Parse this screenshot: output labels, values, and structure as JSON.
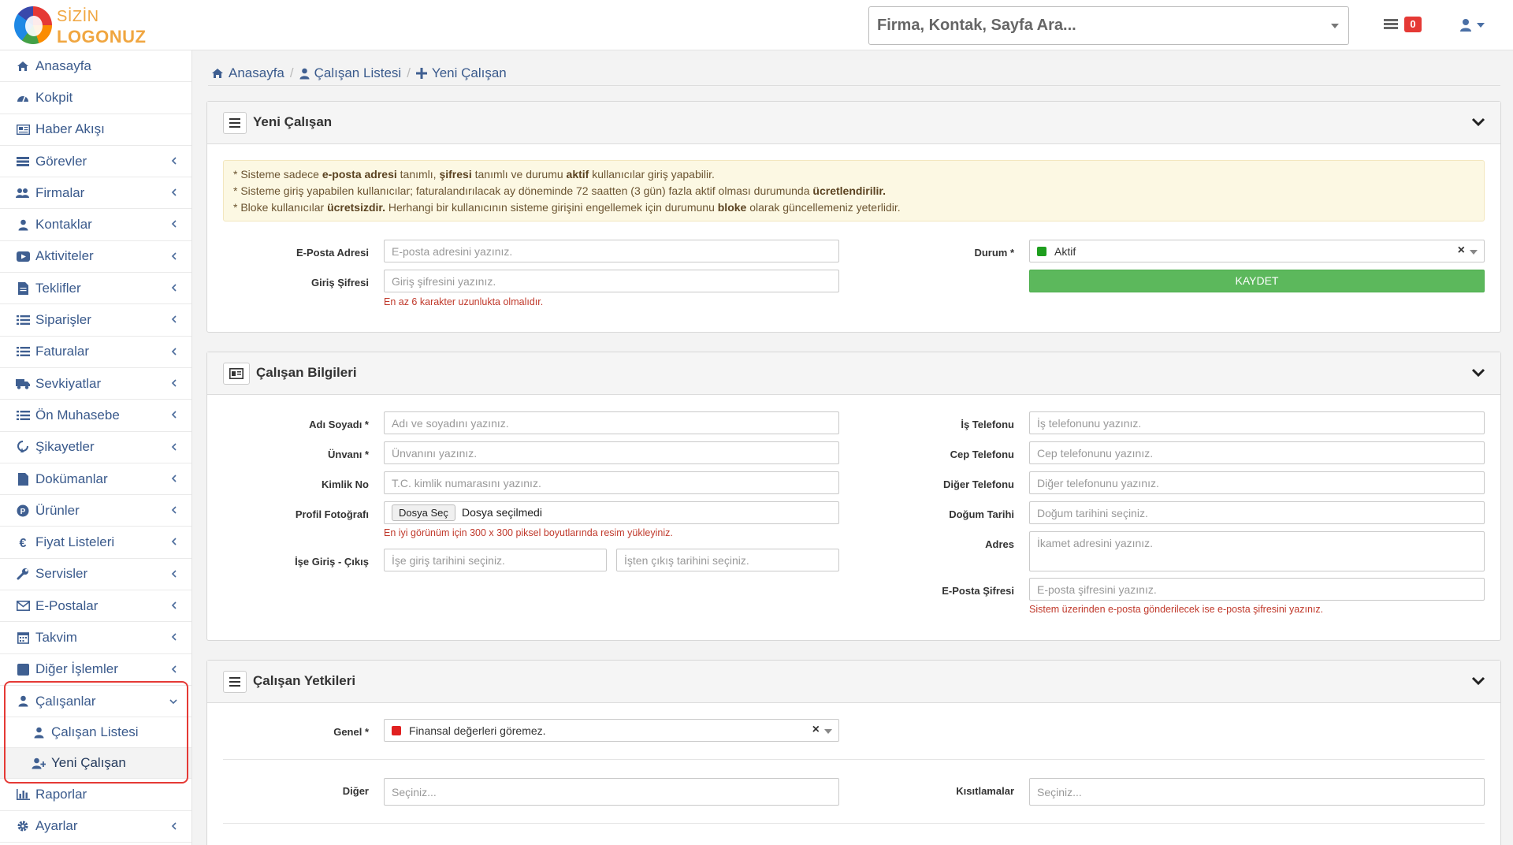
{
  "header": {
    "logo_line1": "SİZİN",
    "logo_line2": "LOGONUZ",
    "search_placeholder": "Firma, Kontak, Sayfa Ara...",
    "notification_count": "0"
  },
  "sidebar": {
    "items": [
      {
        "label": "Anasayfa",
        "icon": "home-icon"
      },
      {
        "label": "Kokpit",
        "icon": "dashboard-icon"
      },
      {
        "label": "Haber Akışı",
        "icon": "newspaper-icon"
      },
      {
        "label": "Görevler",
        "icon": "tasks-icon"
      },
      {
        "label": "Firmalar",
        "icon": "users-icon"
      },
      {
        "label": "Kontaklar",
        "icon": "user-icon"
      },
      {
        "label": "Aktiviteler",
        "icon": "video-icon"
      },
      {
        "label": "Teklifler",
        "icon": "document-icon"
      },
      {
        "label": "Siparişler",
        "icon": "list-icon"
      },
      {
        "label": "Faturalar",
        "icon": "list-icon"
      },
      {
        "label": "Sevkiyatlar",
        "icon": "truck-icon"
      },
      {
        "label": "Ön Muhasebe",
        "icon": "list-icon"
      },
      {
        "label": "Şikayetler",
        "icon": "bullhorn-icon"
      },
      {
        "label": "Dokümanlar",
        "icon": "file-icon"
      },
      {
        "label": "Ürünler",
        "icon": "product-icon"
      },
      {
        "label": "Fiyat Listeleri",
        "icon": "euro-icon"
      },
      {
        "label": "Servisler",
        "icon": "wrench-icon"
      },
      {
        "label": "E-Postalar",
        "icon": "envelope-icon"
      },
      {
        "label": "Takvim",
        "icon": "calendar-icon"
      },
      {
        "label": "Diğer İşlemler",
        "icon": "square-icon"
      },
      {
        "label": "Çalışanlar",
        "icon": "user-icon"
      }
    ],
    "sub_items": [
      {
        "label": "Çalışan Listesi",
        "icon": "user-icon"
      },
      {
        "label": "Yeni Çalışan",
        "icon": "user-plus-icon"
      }
    ],
    "after_items": [
      {
        "label": "Raporlar",
        "icon": "bar-chart-icon"
      },
      {
        "label": "Ayarlar",
        "icon": "gear-icon"
      }
    ]
  },
  "breadcrumb": {
    "home": "Anasayfa",
    "list": "Çalışan Listesi",
    "current": "Yeni Çalışan"
  },
  "panel_new": {
    "title": "Yeni Çalışan",
    "alert": {
      "line1_pre": "* Sisteme sadece ",
      "line1_b1": "e-posta adresi",
      "line1_mid1": " tanımlı, ",
      "line1_b2": "şifresi",
      "line1_mid2": " tanımlı ve durumu ",
      "line1_b3": "aktif",
      "line1_post": " kullanıcılar giriş yapabilir.",
      "line2_pre": "* Sisteme giriş yapabilen kullanıcılar; faturalandırılacak ay döneminde 72 saatten (3 gün) fazla aktif olması durumunda ",
      "line2_b": "ücretlendirilir.",
      "line3_pre": "* Bloke kullanıcılar ",
      "line3_b1": "ücretsizdir.",
      "line3_mid": " Herhangi bir kullanıcının sisteme girişini engellemek için durumunu ",
      "line3_b2": "bloke",
      "line3_post": " olarak güncellemeniz yeterlidir."
    },
    "email_label": "E-Posta Adresi",
    "email_placeholder": "E-posta adresini yazınız.",
    "password_label": "Giriş Şifresi",
    "password_placeholder": "Giriş şifresini yazınız.",
    "password_help": "En az 6 karakter uzunlukta olmalıdır.",
    "status_label": "Durum *",
    "status_value": "Aktif",
    "status_color": "#1e9e1e",
    "save_label": "KAYDET"
  },
  "panel_info": {
    "title": "Çalışan Bilgileri",
    "name_label": "Adı Soyadı *",
    "name_placeholder": "Adı ve soyadını yazınız.",
    "title_label": "Ünvanı *",
    "title_placeholder": "Ünvanını yazınız.",
    "id_label": "Kimlik No",
    "id_placeholder": "T.C. kimlik numarasını yazınız.",
    "photo_label": "Profil Fotoğrafı",
    "photo_button": "Dosya Seç",
    "photo_status": "Dosya seçilmedi",
    "photo_help": "En iyi görünüm için 300 x 300 piksel boyutlarında resim yükleyiniz.",
    "dates_label": "İşe Giriş - Çıkış",
    "start_placeholder": "İşe giriş tarihini seçiniz.",
    "end_placeholder": "İşten çıkış tarihini seçiniz.",
    "work_phone_label": "İş Telefonu",
    "work_phone_placeholder": "İş telefonunu yazınız.",
    "mobile_label": "Cep Telefonu",
    "mobile_placeholder": "Cep telefonunu yazınız.",
    "other_phone_label": "Diğer Telefonu",
    "other_phone_placeholder": "Diğer telefonunu yazınız.",
    "birth_label": "Doğum Tarihi",
    "birth_placeholder": "Doğum tarihini seçiniz.",
    "address_label": "Adres",
    "address_placeholder": "İkamet adresini yazınız.",
    "mail_pw_label": "E-Posta Şifresi",
    "mail_pw_placeholder": "E-posta şifresini yazınız.",
    "mail_pw_help": "Sistem üzerinden e-posta gönderilecek ise e-posta şifresini yazınız."
  },
  "panel_perm": {
    "title": "Çalışan Yetkileri",
    "general_label": "Genel *",
    "general_value": "Finansal değerleri göremez.",
    "general_color": "#e02020",
    "other_label": "Diğer",
    "other_placeholder": "Seçiniz...",
    "restrict_label": "Kısıtlamalar",
    "restrict_placeholder": "Seçiniz..."
  }
}
